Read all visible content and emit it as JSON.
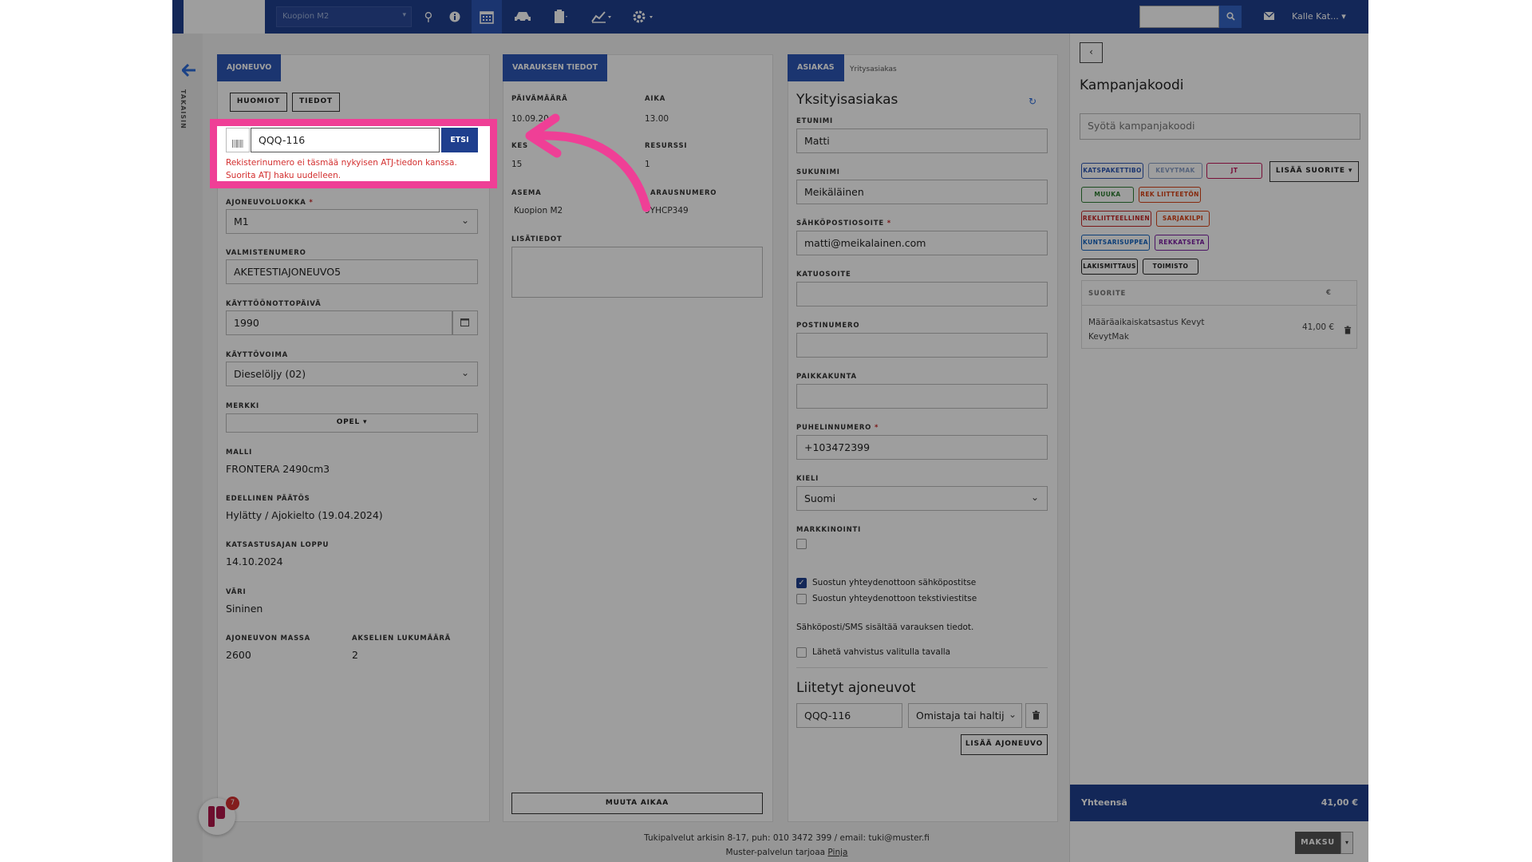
{
  "topbar": {
    "location": "Kuopion M2",
    "user": "Kalle Kat..."
  },
  "back": {
    "label": "TAKAISIN"
  },
  "vehicle": {
    "tab": "AJONEUVO",
    "btn_notes": "HUOMIOT",
    "btn_info": "TIEDOT",
    "reg_value": "QQQ-116",
    "search_btn": "ETSI",
    "error": "Rekisterinumero ei täsmää nykyisen ATJ-tiedon kanssa. Suorita ATJ haku uudelleen.",
    "class_label": "AJONEUVOLUOKKA",
    "class_value": "M1",
    "vin_label": "VALMISTENUMERO",
    "vin_value": "AKETESTIAJONEUVO5",
    "date_label": "KÄYTTÖÖNOTTOPÄIVÄ",
    "date_value": "1990",
    "fuel_label": "KÄYTTÖVOIMA",
    "fuel_value": "Dieselöljy (02)",
    "make_label": "MERKKI",
    "make_value": "OPEL",
    "model_label": "MALLI",
    "model_value": "FRONTERA 2490cm3",
    "prev_label": "EDELLINEN PÄÄTÖS",
    "prev_value": "Hylätty / Ajokielto (19.04.2024)",
    "end_label": "KATSASTUSAJAN LOPPU",
    "end_value": "14.10.2024",
    "color_label": "VÄRI",
    "color_value": "Sininen",
    "mass_label": "AJONEUVON MASSA",
    "mass_value": "2600",
    "axles_label": "AKSELIEN LUKUMÄÄRÄ",
    "axles_value": "2"
  },
  "booking": {
    "tab": "VARAUKSEN TIEDOT",
    "date_label": "PÄIVÄMÄÄRÄ",
    "date_value": "10.09.20",
    "time_label": "AIKA",
    "time_value": "13.00",
    "duration_label": "KES",
    "duration_value": "15",
    "resource_label": "RESURSSI",
    "resource_value": "1",
    "station_label": "ASEMA",
    "station_value": "Kuopion M2",
    "number_label": "ARAUSNUMERO",
    "number_value": "9YHCP349",
    "notes_label": "LISÄTIEDOT",
    "change_time_btn": "MUUTA AIKAA"
  },
  "customer": {
    "tab_active": "ASIAKAS",
    "tab_other": "Yritysasiakas",
    "heading": "Yksityisasiakas",
    "first_label": "ETUNIMI",
    "first_value": "Matti",
    "last_label": "SUKUNIMI",
    "last_value": "Meikäläinen",
    "email_label": "SÄHKÖPOSTIOSOITE",
    "email_value": "matti@meikalainen.com",
    "street_label": "KATUOSOITE",
    "zip_label": "POSTINUMERO",
    "city_label": "PAIKKAKUNTA",
    "phone_label": "PUHELINNUMERO",
    "phone_value": "+103472399",
    "lang_label": "KIELI",
    "lang_value": "Suomi",
    "marketing_label": "MARKKINOINTI",
    "consent_email": "Suostun yhteydenottoon sähköpostitse",
    "consent_sms": "Suostun yhteydenottoon tekstiviestitse",
    "info_note": "Sähköposti/SMS sisältää varauksen tiedot.",
    "send_confirm": "Lähetä vahvistus valitulla tavalla",
    "linked_heading": "Liitetyt ajoneuvot",
    "linked_reg": "QQQ-116",
    "linked_role": "Omistaja tai haltij",
    "add_vehicle_btn": "LISÄÄ AJONEUVO"
  },
  "campaign": {
    "title": "Kampanjakoodi",
    "placeholder": "Syötä kampanjakoodi",
    "chips": [
      {
        "label": "KATSPAKETTIBO",
        "color": "#2c56b5"
      },
      {
        "label": "KEVYTMAK",
        "color": "#8aa0c8"
      },
      {
        "label": "JT",
        "color": "#c2185b"
      },
      {
        "label": "MUUKA",
        "color": "#2e7d32"
      },
      {
        "label": "REK LIITTEETÖN",
        "color": "#d84315"
      },
      {
        "label": "REKLIITTEELLINEN",
        "color": "#c62828"
      },
      {
        "label": "SARJAKILPI",
        "color": "#d84315"
      },
      {
        "label": "KUNTSARISUPPEA",
        "color": "#1565c0"
      },
      {
        "label": "REKKATSETA",
        "color": "#7b1fa2"
      },
      {
        "label": "LAKISMITTAUS",
        "color": "#222222"
      },
      {
        "label": "TOIMISTO",
        "color": "#222222"
      }
    ],
    "add_service_btn": "LISÄÄ SUORITE",
    "table_header": "SUORITE",
    "table_currency": "€",
    "service_name": "Määräaikaiskatsastus Kevyt KevytMak",
    "service_price": "41,00 €",
    "total_label": "Yhteensä",
    "total_value": "41,00 €",
    "pay_btn": "MAKSU"
  },
  "footer": {
    "line1": "Tukipalvelut arkisin 8-17, puh: 010 3472 399 / email: tuki@muster.fi",
    "line2_prefix": "Muster-palvelun tarjoaa",
    "line2_link": "Pinja"
  },
  "notifications": {
    "count": "7"
  }
}
